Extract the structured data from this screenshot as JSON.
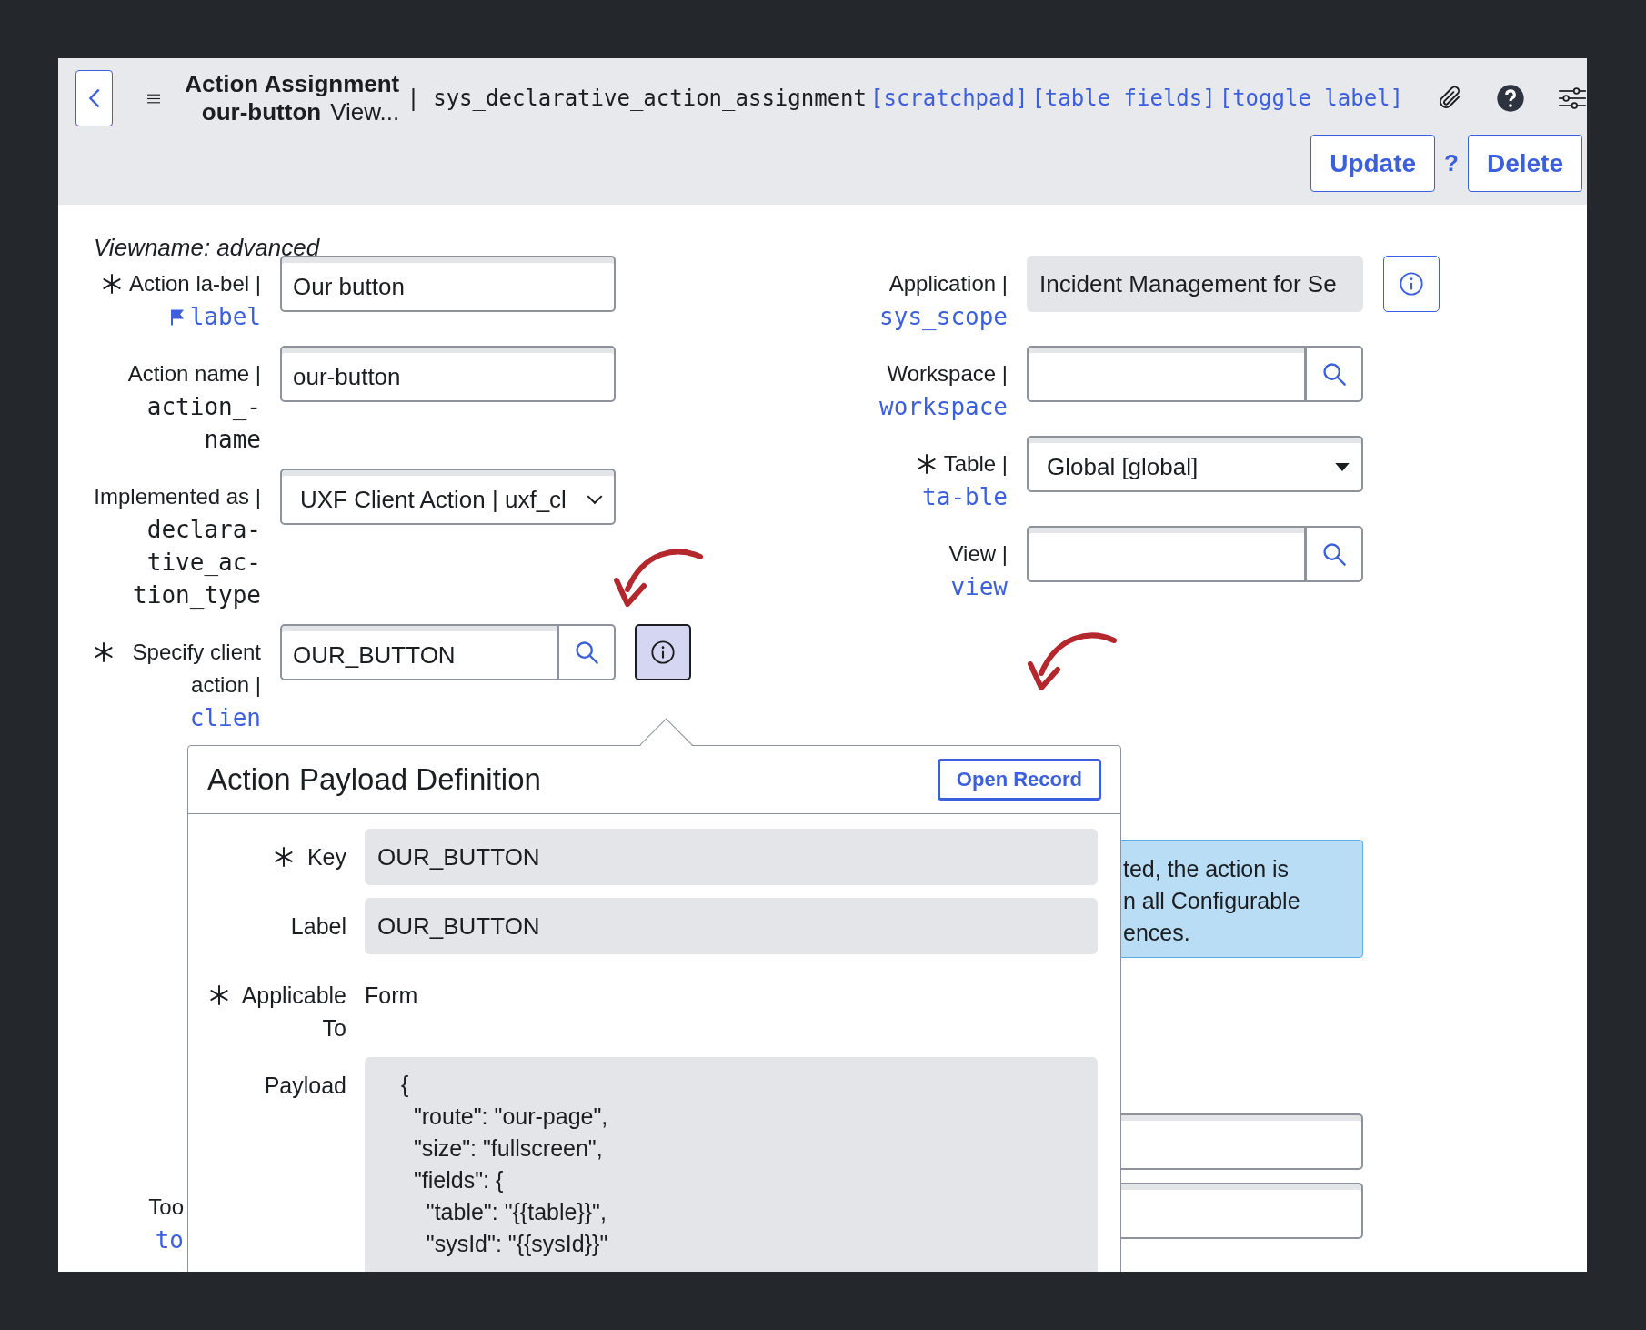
{
  "header": {
    "title": "Action Assignment",
    "subtitle": "our-button",
    "view_link": "View...",
    "table_name": "| sys_declarative_action_assignment",
    "links": [
      "[scratchpad]",
      "[table fields]",
      "[toggle label]"
    ]
  },
  "actions": [
    {
      "kind": "button",
      "label": "Update"
    },
    {
      "kind": "help",
      "label": "?"
    },
    {
      "kind": "button",
      "label": "Delete"
    }
  ],
  "viewname": "Viewname: advanced",
  "left_fields": [
    {
      "kind": "text",
      "required": true,
      "flagged": true,
      "label": "Action la-bel |",
      "field_name": "label",
      "linked": true,
      "value": "Our button"
    },
    {
      "kind": "text",
      "required": false,
      "flagged": false,
      "label": "Action name |",
      "field_name": "action_-name",
      "linked": false,
      "value": "our-button"
    },
    {
      "kind": "select",
      "required": false,
      "flagged": false,
      "label": "Implemented as |",
      "field_name": "declara-tive_ac-tion_type",
      "linked": false,
      "value": "UXF Client Action | uxf_cl"
    },
    {
      "kind": "reference",
      "required": true,
      "flagged": false,
      "label": "Specify client action |",
      "field_name": "clien",
      "linked": true,
      "value": "OUR_BUTTON",
      "info_button": {
        "selected": true
      }
    },
    {
      "kind": "label_only",
      "required": false,
      "flagged": false,
      "label": "Too",
      "field_name": "to",
      "linked": true
    }
  ],
  "right_fields": [
    {
      "kind": "readonly",
      "required": false,
      "label": "Application |",
      "field_name": "sys_scope",
      "linked": true,
      "value": "Incident Management for Se",
      "info_button": {
        "selected": false
      }
    },
    {
      "kind": "reference",
      "required": false,
      "label": "Workspace |",
      "field_name": "workspace",
      "linked": true
    },
    {
      "kind": "dropdown",
      "required": true,
      "label": "Table |",
      "field_name": "ta-ble",
      "linked": true,
      "value": "Global [global]"
    },
    {
      "kind": "reference",
      "required": false,
      "label": "View |",
      "field_name": "view",
      "linked": true
    }
  ],
  "note": {
    "lines": [
      "ted, the action is",
      "n all Configurable",
      "ences."
    ]
  },
  "lower_fields": [
    {
      "kind": "text"
    },
    {
      "kind": "text"
    }
  ],
  "popover": {
    "title": "Action Payload Definition",
    "button": "Open Record",
    "fields": [
      {
        "kind": "readonly",
        "required": true,
        "label": "Key",
        "value": "OUR_BUTTON"
      },
      {
        "kind": "readonly",
        "required": false,
        "label": "Label",
        "value": "OUR_BUTTON"
      },
      {
        "kind": "plain",
        "required": true,
        "label": "Applicable To",
        "value": "Form"
      },
      {
        "kind": "code",
        "required": false,
        "label": "Payload",
        "lines": [
          "{",
          "  \"route\": \"our-page\",",
          "  \"size\": \"fullscreen\",",
          "  \"fields\": {",
          "    \"table\": \"{{table}}\",",
          "    \"sysId\": \"{{sysId}}\""
        ]
      }
    ]
  }
}
